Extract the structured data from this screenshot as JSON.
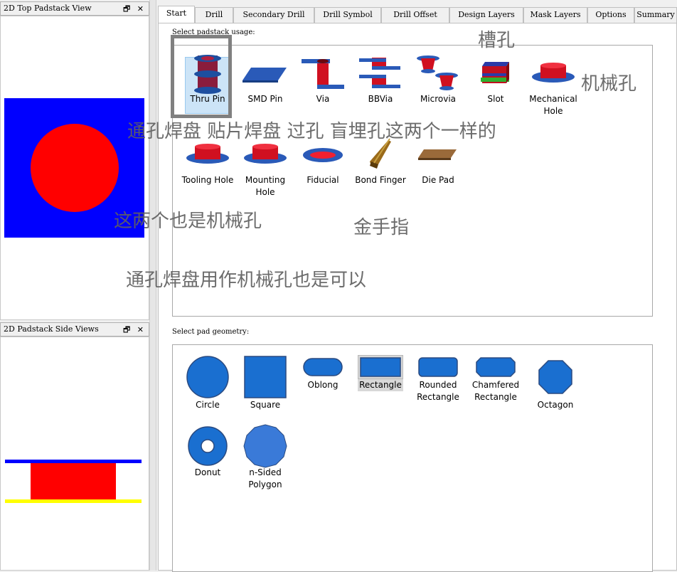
{
  "panels": {
    "top_view": {
      "title": "2D Top Padstack View",
      "controls": "🗗 ✕"
    },
    "side_view": {
      "title": "2D Padstack Side Views",
      "controls": "🗗 ✕"
    }
  },
  "tabs": [
    "Start",
    "Drill",
    "Secondary Drill",
    "Drill Symbol",
    "Drill Offset",
    "Design Layers",
    "Mask Layers",
    "Options",
    "Summary"
  ],
  "usage": {
    "label": "Select padstack usage:",
    "items": [
      "Thru Pin",
      "SMD Pin",
      "Via",
      "BBVia",
      "Microvia",
      "Slot",
      "Mechanical Hole",
      "Tooling Hole",
      "Mounting Hole",
      "Fiducial",
      "Bond Finger",
      "Die Pad"
    ],
    "selected": "Thru Pin"
  },
  "geometry": {
    "label": "Select pad geometry:",
    "items": [
      "Circle",
      "Square",
      "Oblong",
      "Rectangle",
      "Rounded Rectangle",
      "Chamfered Rectangle",
      "Octagon",
      "Donut",
      "n-Sided Polygon"
    ],
    "selected": "Rectangle"
  },
  "annotations": {
    "slot": "槽孔",
    "mech": "机械孔",
    "via_note": "通孔焊盘 贴片焊盘 过孔 盲埋孔这两个一样的",
    "tooling_note": "这两个也是机械孔",
    "bond_note": "金手指",
    "thru_note": "通孔焊盘用作机械孔也是可以"
  },
  "colors": {
    "pad_blue": "#0000ff",
    "drill_red": "#ff0000",
    "side_yellow": "#ffff00",
    "geom_blue": "#1a6fd0"
  }
}
